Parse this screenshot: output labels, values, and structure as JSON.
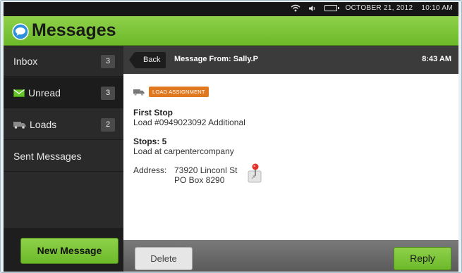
{
  "status_bar": {
    "date": "OCTOBER 21, 2012",
    "time": "10:10 AM",
    "icons": [
      "wifi-icon",
      "speaker-icon",
      "battery-icon"
    ]
  },
  "app": {
    "title": "Messages",
    "icon": "chat-bubble-icon",
    "accent_color": "#7cc23a"
  },
  "sidebar": {
    "items": [
      {
        "label": "Inbox",
        "count": "3",
        "icon": ""
      },
      {
        "label": "Unread",
        "count": "3",
        "icon": "envelope-icon"
      },
      {
        "label": "Loads",
        "count": "2",
        "icon": "truck-icon"
      },
      {
        "label": "Sent Messages",
        "count": "",
        "icon": ""
      }
    ],
    "new_message_label": "New Message"
  },
  "message": {
    "back_label": "Back",
    "from": "Message From: Sally.P",
    "time": "8:43 AM",
    "tag": "LOAD ASSIGNMENT",
    "tag_color": "#e0781f",
    "first_stop_title": "First Stop",
    "first_stop_detail": "Load #0949023092 Additional",
    "stops_title": "Stops: 5",
    "stops_detail": "Load at carpentercompany",
    "address_label": "Address:",
    "address_line1": "73920 Linconl St",
    "address_line2": "PO Box 8290"
  },
  "actions": {
    "delete_label": "Delete",
    "reply_label": "Reply"
  }
}
